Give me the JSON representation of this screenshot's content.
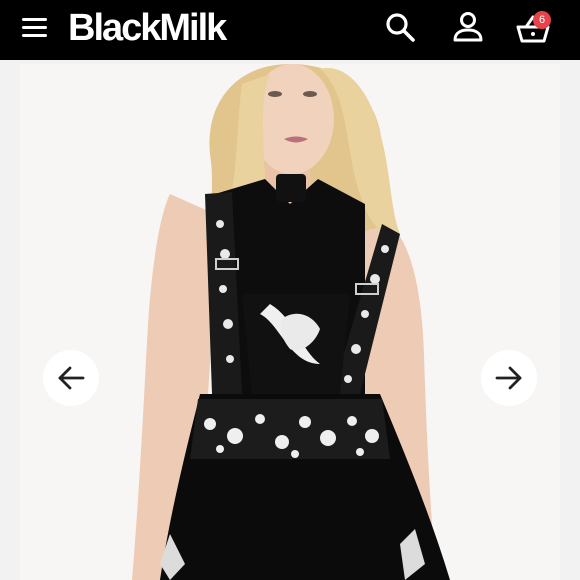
{
  "header": {
    "brand": "BlackMilk",
    "cart_count": "6"
  },
  "icons": {
    "menu": "hamburger-menu-icon",
    "search": "search-icon",
    "account": "account-icon",
    "cart": "shopping-basket-icon",
    "prev": "arrow-left-icon",
    "next": "arrow-right-icon"
  },
  "colors": {
    "header_bg": "#000000",
    "badge": "#e8424b"
  }
}
